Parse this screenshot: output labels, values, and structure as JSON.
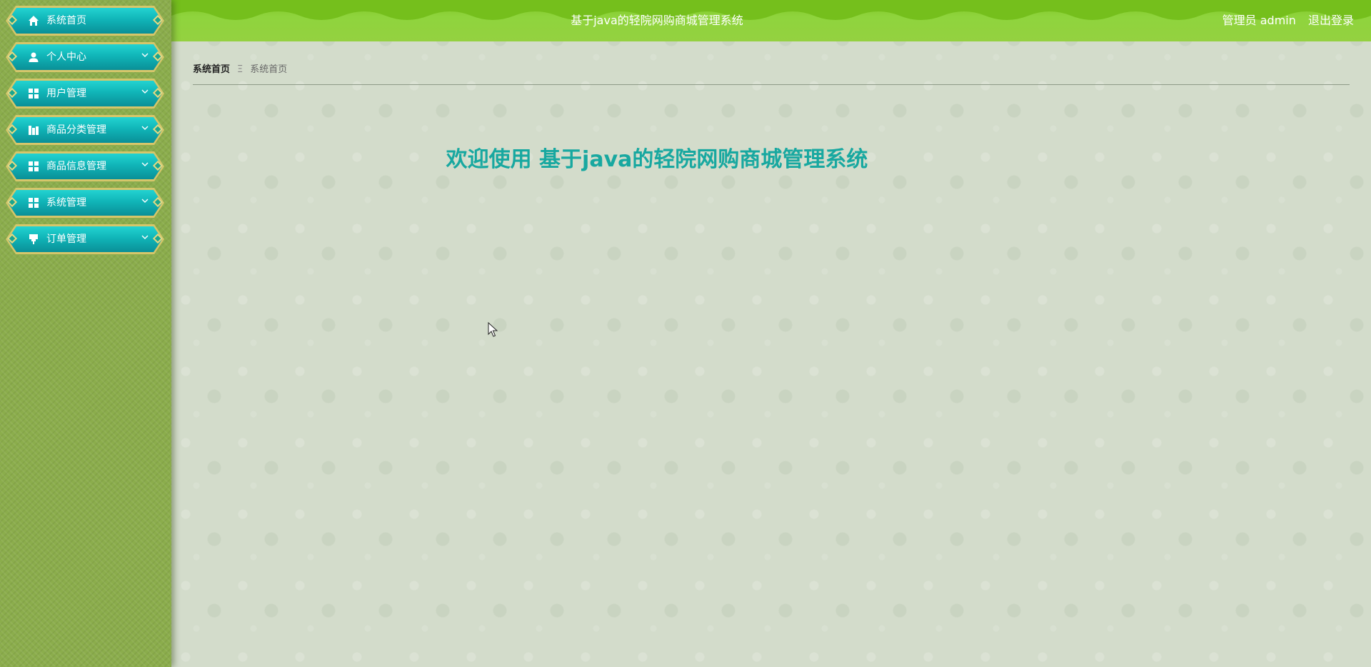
{
  "header": {
    "title": "基于java的轻院网购商城管理系统",
    "user": "管理员 admin",
    "logout": "退出登录"
  },
  "sidebar": {
    "items": [
      {
        "label": "系统首页",
        "icon": "home-icon",
        "has_submenu": false
      },
      {
        "label": "个人中心",
        "icon": "user-icon",
        "has_submenu": true
      },
      {
        "label": "用户管理",
        "icon": "grid-icon",
        "has_submenu": true
      },
      {
        "label": "商品分类管理",
        "icon": "category-icon",
        "has_submenu": true
      },
      {
        "label": "商品信息管理",
        "icon": "grid-icon",
        "has_submenu": true
      },
      {
        "label": "系统管理",
        "icon": "grid-icon",
        "has_submenu": true
      },
      {
        "label": "订单管理",
        "icon": "order-icon",
        "has_submenu": true
      }
    ]
  },
  "breadcrumb": {
    "first": "系统首页",
    "separator": "Ξ",
    "current": "系统首页"
  },
  "main": {
    "welcome": "欢迎使用 基于java的轻院网购商城管理系统"
  },
  "colors": {
    "sidebar_bg": "#8bad4c",
    "header_bg": "#8fd43d",
    "menu_teal": "#10b5b8",
    "menu_border": "#d6c66a",
    "welcome_text": "#18a8a0",
    "page_bg": "#d3dccb"
  }
}
